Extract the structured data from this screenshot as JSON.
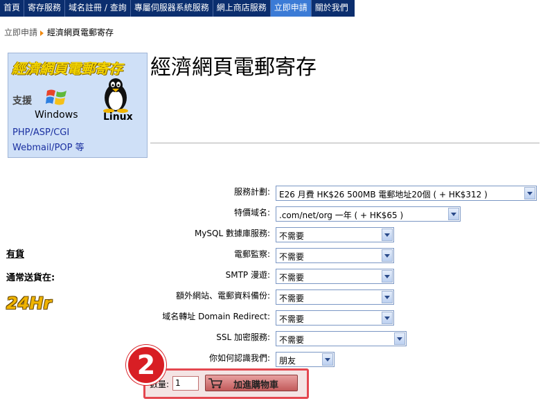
{
  "nav": {
    "items": [
      "首頁",
      "寄存服務",
      "域名註冊 / 查詢",
      "專屬伺服器系統服務",
      "網上商店服務",
      "立即申請",
      "關於我們"
    ],
    "active_index": 5
  },
  "breadcrumb": {
    "parent": "立即申請",
    "current": "經濟網頁電郵寄存"
  },
  "banner": {
    "title": "經濟網頁電郵寄存",
    "support": "支援",
    "windows": "Windows",
    "linux": "Linux",
    "langs": "PHP/ASP/CGI",
    "webmail": "Webmail/POP  等"
  },
  "page_title": "經濟網頁電郵寄存",
  "availability": {
    "stock": "有貨",
    "ship_label": "通常送貨在:",
    "ship_time": "24Hr"
  },
  "form": {
    "plan": {
      "label": "服務計劃:",
      "value": "E26 月費 HK$26 500MB 電郵地址20個 ( + HK$312 )"
    },
    "domain": {
      "label": "特價域名:",
      "value": ".com/net/org 一年 ( + HK$65 )"
    },
    "mysql": {
      "label": "MySQL 數據庫服務:",
      "value": "不需要"
    },
    "monitor": {
      "label": "電郵監察:",
      "value": "不需要"
    },
    "smtp": {
      "label": "SMTP 漫遊:",
      "value": "不需要"
    },
    "backup": {
      "label": "額外網站、電郵資料備份:",
      "value": "不需要"
    },
    "redirect": {
      "label": "域名轉址 Domain Redirect:",
      "value": "不需要"
    },
    "ssl": {
      "label": "SSL 加密服務:",
      "value": "不需要"
    },
    "referral": {
      "label": "你如何認識我們:",
      "value": "朋友"
    }
  },
  "cart": {
    "qty_label": "數量:",
    "qty_value": "1",
    "button_label": "加進購物車"
  },
  "step_badge": "2",
  "colors": {
    "nav_bg": "#0b2e6e",
    "nav_active": "#3b7bd6",
    "highlight": "#e4474f"
  }
}
